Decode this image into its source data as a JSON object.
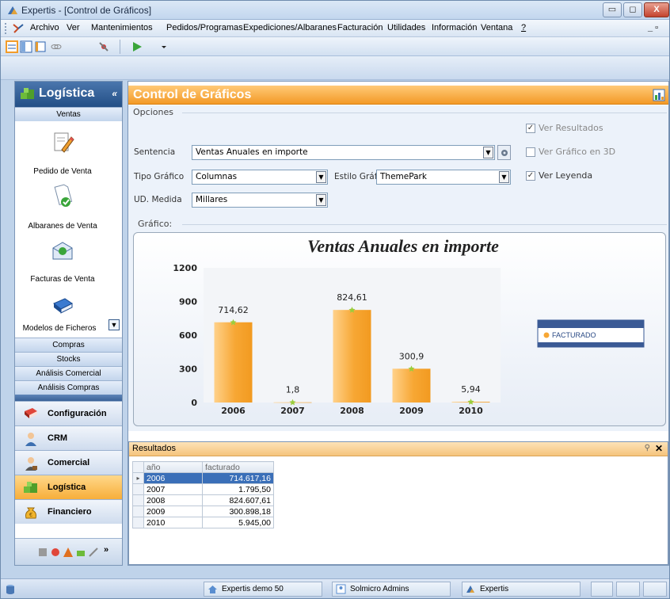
{
  "window": {
    "title": "Expertis - [Control de Gráficos]"
  },
  "menu": [
    "Archivo",
    "Ver",
    "Mantenimientos",
    "Pedidos/Programas",
    "Expediciones/Albaranes",
    "Facturación",
    "Utilidades",
    "Información",
    "Ventana",
    "?"
  ],
  "sidebar": {
    "title": "Logística",
    "collapse_glyph": "«",
    "sections_top": [
      "Ventas"
    ],
    "items": [
      {
        "label": "Pedido de Venta",
        "icon": "pen-document-icon"
      },
      {
        "label": "Albaranes de Venta",
        "icon": "delivery-note-icon"
      },
      {
        "label": "Facturas de Venta",
        "icon": "invoice-icon"
      },
      {
        "label": "Modelos de Ficheros",
        "icon": "book-icon"
      }
    ],
    "sections": [
      "Compras",
      "Stocks",
      "Análisis Comercial",
      "Análisis Compras"
    ],
    "modules": [
      {
        "label": "Configuración",
        "icon": "book-red-icon"
      },
      {
        "label": "CRM",
        "icon": "user-icon"
      },
      {
        "label": "Comercial",
        "icon": "salesman-icon"
      },
      {
        "label": "Logística",
        "icon": "boxes-icon",
        "active": true
      },
      {
        "label": "Financiero",
        "icon": "money-bag-icon"
      }
    ]
  },
  "main": {
    "title": "Control de Gráficos",
    "opciones_label": "Opciones",
    "sentencia_label": "Sentencia",
    "sentencia_value": "Ventas Anuales  en importe",
    "tipo_label": "Tipo Gráfico",
    "tipo_value": "Columnas",
    "estilo_label": "Estilo Gráfi",
    "estilo_value": "ThemePark",
    "ud_label": "UD. Medida",
    "ud_value": "Millares",
    "checks": [
      {
        "label": "Ver Resultados",
        "checked": true,
        "enabled": false
      },
      {
        "label": "Ver Gráfico en 3D",
        "checked": false,
        "enabled": false
      },
      {
        "label": "Ver Leyenda",
        "checked": true,
        "enabled": true
      }
    ],
    "grafico_label": "Gráfico:"
  },
  "chart_data": {
    "type": "bar",
    "title": "Ventas Anuales  en importe",
    "categories": [
      "2006",
      "2007",
      "2008",
      "2009",
      "2010"
    ],
    "series": [
      {
        "name": "FACTURADO",
        "values": [
          714.62,
          1.8,
          824.61,
          300.9,
          5.94
        ]
      }
    ],
    "data_labels": [
      "714,62",
      "1,8",
      "824,61",
      "300,9",
      "5,94"
    ],
    "yticks": [
      "0",
      "300",
      "600",
      "900",
      "1200"
    ],
    "ylim": [
      0,
      1200
    ],
    "legend_position": "right",
    "colors": {
      "bar": "#f7a734",
      "bar_light": "#ffd18a",
      "marker": "#9acd3c"
    }
  },
  "results": {
    "title": "Resultados",
    "pin_glyph": "⚲",
    "close_glyph": "✕",
    "columns": [
      "año",
      "facturado"
    ],
    "rows": [
      [
        "2006",
        "714.617,16"
      ],
      [
        "2007",
        "1.795,50"
      ],
      [
        "2008",
        "824.607,61"
      ],
      [
        "2009",
        "300.898,18"
      ],
      [
        "2010",
        "5.945,00"
      ]
    ]
  },
  "status": [
    "Expertis demo 50",
    "Solmicro Admins",
    "Expertis"
  ]
}
